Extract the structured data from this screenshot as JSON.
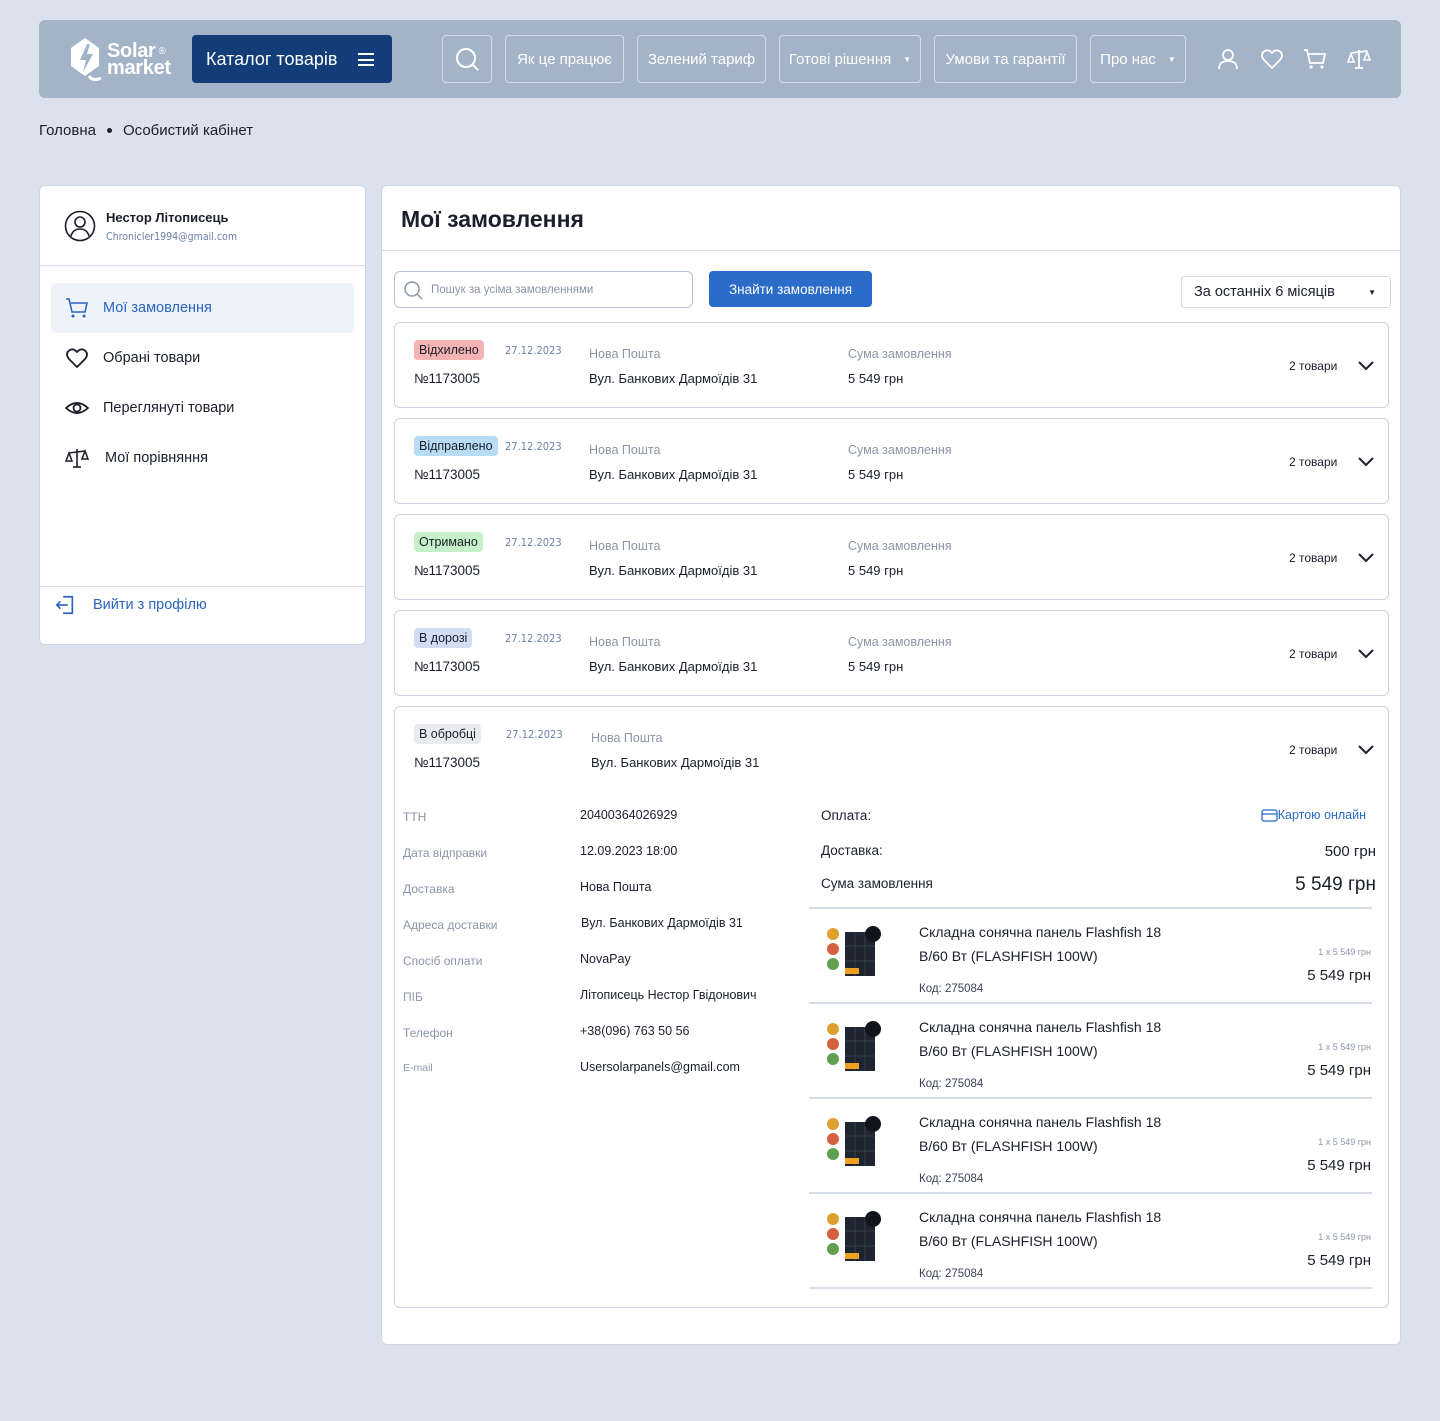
{
  "header": {
    "logo_line1": "Solar",
    "logo_line2": "market",
    "logo_reg": "®",
    "catalog_label": "Каталог товарів",
    "nav": [
      "Як це працює",
      "Зелений тариф",
      "Готові рішення",
      "Умови та гарантії",
      "Про нас"
    ]
  },
  "breadcrumb": {
    "home": "Головна",
    "current": "Особистий кабінет"
  },
  "sidebar": {
    "user_name": "Нестор Літописець",
    "user_email": "Chronicler1994@gmail.com",
    "items": [
      "Мої замовлення",
      "Обрані товари",
      "Переглянуті товари",
      "Мої порівняння"
    ],
    "logout": "Вийти з профілю"
  },
  "main": {
    "title": "Мої замовлення",
    "search_placeholder": "Пошук за усіма замовленнями",
    "find_button": "Знайти замовлення",
    "period": "За останніх 6 місяців"
  },
  "colors": {
    "accent": "#2a6cc8",
    "catalog": "#123d78",
    "header_bg": "#a3b3c8",
    "status_rejected": "#f5b3b3",
    "status_sent": "#b9dcf5",
    "status_received": "#c5f0c9",
    "status_transit": "#d2dcf3",
    "status_processing": "#e9ebee"
  },
  "orders": [
    {
      "status": "Відхилено",
      "date": "27.12.2023",
      "number": "№1173005",
      "carrier": "Нова Пошта",
      "address": "Вул. Банкових Дармоїдів 31",
      "sum_label": "Сума замовлення",
      "sum": "5 549 грн",
      "count": "2 товари"
    },
    {
      "status": "Відправлено",
      "date": "27.12.2023",
      "number": "№1173005",
      "carrier": "Нова Пошта",
      "address": "Вул. Банкових Дармоїдів 31",
      "sum_label": "Сума замовлення",
      "sum": "5 549 грн",
      "count": "2 товари"
    },
    {
      "status": "Отримано",
      "date": "27.12.2023",
      "number": "№1173005",
      "carrier": "Нова Пошта",
      "address": "Вул. Банкових Дармоїдів 31",
      "sum_label": "Сума замовлення",
      "sum": "5 549 грн",
      "count": "2 товари"
    },
    {
      "status": "В дорозі",
      "date": "27.12.2023",
      "number": "№1173005",
      "carrier": "Нова Пошта",
      "address": "Вул. Банкових Дармоїдів 31",
      "sum_label": "Сума замовлення",
      "sum": "5 549 грн",
      "count": "2 товари"
    }
  ],
  "expanded": {
    "status": "В обробці",
    "date": "27.12.2023",
    "number": "№1173005",
    "carrier": "Нова Пошта",
    "address": "Вул. Банкових Дармоїдів 31",
    "count": "2 товари",
    "details": [
      {
        "label": "ТТН",
        "value": "20400364026929"
      },
      {
        "label": "Дата відправки",
        "value": "12.09.2023 18:00"
      },
      {
        "label": "Доставка",
        "value": "Нова Пошта"
      },
      {
        "label": "Адреса доставки",
        "value": "Вул. Банкових Дармоїдів 31"
      },
      {
        "label": "Спосіб оплати",
        "value": "NovaPay"
      },
      {
        "label": "ПІБ",
        "value": "Літописець Нестор Гвідонович"
      },
      {
        "label": "Телефон",
        "value": "+38(096) 763 50 56"
      },
      {
        "label": "E-mail",
        "value": "Usersolarpanels@gmail.com"
      }
    ],
    "payment_label": "Оплата:",
    "payment_value": "Картою онлайн",
    "delivery_label": "Доставка:",
    "delivery_value": "500 грн",
    "total_label": "Сума замовлення",
    "total_value": "5 549 грн",
    "products": [
      {
        "title": "Складна сонячна панель Flashfish 18 В/60 Вт (FLASHFISH 100W)",
        "code": "Код: 275084",
        "qty": "1 x 5 549 грн",
        "price": "5 549 грн"
      },
      {
        "title": "Складна сонячна панель Flashfish 18 В/60 Вт (FLASHFISH 100W)",
        "code": "Код: 275084",
        "qty": "1 x 5 549 грн",
        "price": "5 549 грн"
      },
      {
        "title": "Складна сонячна панель Flashfish 18 В/60 Вт (FLASHFISH 100W)",
        "code": "Код: 275084",
        "qty": "1 x 5 549 грн",
        "price": "5 549 грн"
      },
      {
        "title": "Складна сонячна панель Flashfish 18 В/60 Вт (FLASHFISH 100W)",
        "code": "Код: 275084",
        "qty": "1 x 5 549 грн",
        "price": "5 549 грн"
      }
    ]
  }
}
